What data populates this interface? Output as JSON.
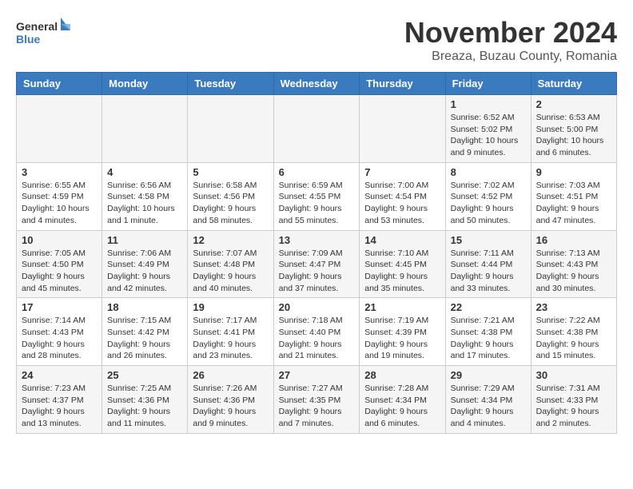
{
  "header": {
    "logo_line1": "General",
    "logo_line2": "Blue",
    "title": "November 2024",
    "location": "Breaza, Buzau County, Romania"
  },
  "weekdays": [
    "Sunday",
    "Monday",
    "Tuesday",
    "Wednesday",
    "Thursday",
    "Friday",
    "Saturday"
  ],
  "weeks": [
    [
      {
        "day": "",
        "info": ""
      },
      {
        "day": "",
        "info": ""
      },
      {
        "day": "",
        "info": ""
      },
      {
        "day": "",
        "info": ""
      },
      {
        "day": "",
        "info": ""
      },
      {
        "day": "1",
        "info": "Sunrise: 6:52 AM\nSunset: 5:02 PM\nDaylight: 10 hours and 9 minutes."
      },
      {
        "day": "2",
        "info": "Sunrise: 6:53 AM\nSunset: 5:00 PM\nDaylight: 10 hours and 6 minutes."
      }
    ],
    [
      {
        "day": "3",
        "info": "Sunrise: 6:55 AM\nSunset: 4:59 PM\nDaylight: 10 hours and 4 minutes."
      },
      {
        "day": "4",
        "info": "Sunrise: 6:56 AM\nSunset: 4:58 PM\nDaylight: 10 hours and 1 minute."
      },
      {
        "day": "5",
        "info": "Sunrise: 6:58 AM\nSunset: 4:56 PM\nDaylight: 9 hours and 58 minutes."
      },
      {
        "day": "6",
        "info": "Sunrise: 6:59 AM\nSunset: 4:55 PM\nDaylight: 9 hours and 55 minutes."
      },
      {
        "day": "7",
        "info": "Sunrise: 7:00 AM\nSunset: 4:54 PM\nDaylight: 9 hours and 53 minutes."
      },
      {
        "day": "8",
        "info": "Sunrise: 7:02 AM\nSunset: 4:52 PM\nDaylight: 9 hours and 50 minutes."
      },
      {
        "day": "9",
        "info": "Sunrise: 7:03 AM\nSunset: 4:51 PM\nDaylight: 9 hours and 47 minutes."
      }
    ],
    [
      {
        "day": "10",
        "info": "Sunrise: 7:05 AM\nSunset: 4:50 PM\nDaylight: 9 hours and 45 minutes."
      },
      {
        "day": "11",
        "info": "Sunrise: 7:06 AM\nSunset: 4:49 PM\nDaylight: 9 hours and 42 minutes."
      },
      {
        "day": "12",
        "info": "Sunrise: 7:07 AM\nSunset: 4:48 PM\nDaylight: 9 hours and 40 minutes."
      },
      {
        "day": "13",
        "info": "Sunrise: 7:09 AM\nSunset: 4:47 PM\nDaylight: 9 hours and 37 minutes."
      },
      {
        "day": "14",
        "info": "Sunrise: 7:10 AM\nSunset: 4:45 PM\nDaylight: 9 hours and 35 minutes."
      },
      {
        "day": "15",
        "info": "Sunrise: 7:11 AM\nSunset: 4:44 PM\nDaylight: 9 hours and 33 minutes."
      },
      {
        "day": "16",
        "info": "Sunrise: 7:13 AM\nSunset: 4:43 PM\nDaylight: 9 hours and 30 minutes."
      }
    ],
    [
      {
        "day": "17",
        "info": "Sunrise: 7:14 AM\nSunset: 4:43 PM\nDaylight: 9 hours and 28 minutes."
      },
      {
        "day": "18",
        "info": "Sunrise: 7:15 AM\nSunset: 4:42 PM\nDaylight: 9 hours and 26 minutes."
      },
      {
        "day": "19",
        "info": "Sunrise: 7:17 AM\nSunset: 4:41 PM\nDaylight: 9 hours and 23 minutes."
      },
      {
        "day": "20",
        "info": "Sunrise: 7:18 AM\nSunset: 4:40 PM\nDaylight: 9 hours and 21 minutes."
      },
      {
        "day": "21",
        "info": "Sunrise: 7:19 AM\nSunset: 4:39 PM\nDaylight: 9 hours and 19 minutes."
      },
      {
        "day": "22",
        "info": "Sunrise: 7:21 AM\nSunset: 4:38 PM\nDaylight: 9 hours and 17 minutes."
      },
      {
        "day": "23",
        "info": "Sunrise: 7:22 AM\nSunset: 4:38 PM\nDaylight: 9 hours and 15 minutes."
      }
    ],
    [
      {
        "day": "24",
        "info": "Sunrise: 7:23 AM\nSunset: 4:37 PM\nDaylight: 9 hours and 13 minutes."
      },
      {
        "day": "25",
        "info": "Sunrise: 7:25 AM\nSunset: 4:36 PM\nDaylight: 9 hours and 11 minutes."
      },
      {
        "day": "26",
        "info": "Sunrise: 7:26 AM\nSunset: 4:36 PM\nDaylight: 9 hours and 9 minutes."
      },
      {
        "day": "27",
        "info": "Sunrise: 7:27 AM\nSunset: 4:35 PM\nDaylight: 9 hours and 7 minutes."
      },
      {
        "day": "28",
        "info": "Sunrise: 7:28 AM\nSunset: 4:34 PM\nDaylight: 9 hours and 6 minutes."
      },
      {
        "day": "29",
        "info": "Sunrise: 7:29 AM\nSunset: 4:34 PM\nDaylight: 9 hours and 4 minutes."
      },
      {
        "day": "30",
        "info": "Sunrise: 7:31 AM\nSunset: 4:33 PM\nDaylight: 9 hours and 2 minutes."
      }
    ]
  ]
}
